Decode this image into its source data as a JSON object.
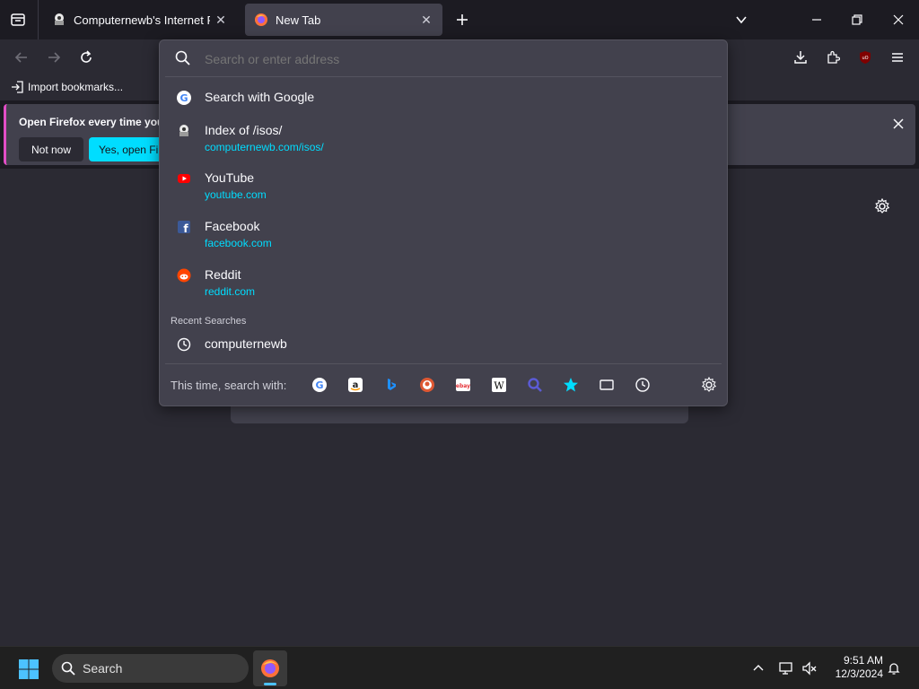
{
  "tabs": [
    {
      "title": "Computernewb's Internet Pub | ",
      "close": "✕"
    },
    {
      "title": "New Tab",
      "close": "✕"
    }
  ],
  "bookmarks": {
    "import_label": "Import bookmarks..."
  },
  "notification": {
    "text": "Open Firefox every time you",
    "not_now": "Not now",
    "yes_open": "Yes, open Fire"
  },
  "urlbar": {
    "placeholder": "Search or enter address"
  },
  "suggestions": [
    {
      "title": "Search with Google",
      "url": ""
    },
    {
      "title": "Index of /isos/",
      "url": "computernewb.com/isos/"
    },
    {
      "title": "YouTube",
      "url": "youtube.com"
    },
    {
      "title": "Facebook",
      "url": "facebook.com"
    },
    {
      "title": "Reddit",
      "url": "reddit.com"
    }
  ],
  "recent": {
    "heading": "Recent Searches",
    "items": [
      "computernewb"
    ]
  },
  "search_with": {
    "label": "This time, search with:"
  },
  "taskbar": {
    "search_label": "Search",
    "time": "9:51 AM",
    "date": "12/3/2024"
  },
  "colors": {
    "accent": "#00ddff",
    "panel": "#42414d",
    "toolbar": "#2b2a33",
    "background": "#1c1b22",
    "ublock": "#800000"
  }
}
